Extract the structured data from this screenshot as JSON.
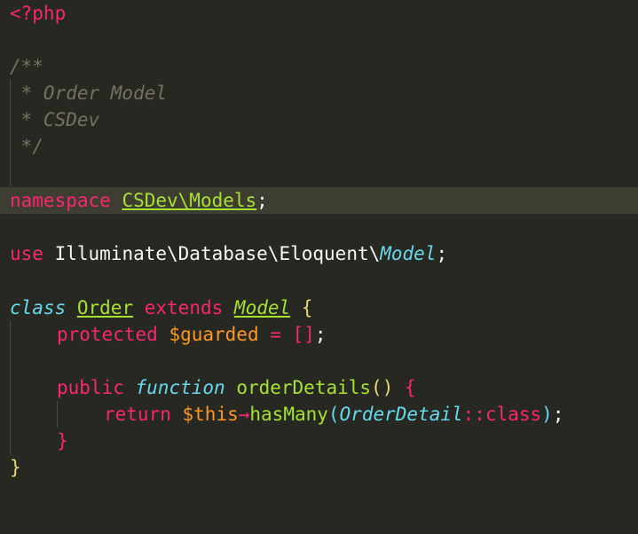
{
  "editor": {
    "language": "php",
    "theme": {
      "background": "#272822",
      "current_line": "#3e3d32",
      "keyword": "#f92672",
      "storage": "#66d9ef",
      "class_name": "#a6e22e",
      "variable": "#fd971f",
      "comment": "#75715e",
      "text": "#f8f8f2"
    },
    "lines": {
      "l1": {
        "open_tag": "<?php"
      },
      "l3": {
        "doc_open": "/**"
      },
      "l4": {
        "doc_text": " * Order Model"
      },
      "l5": {
        "doc_text": " * CSDev"
      },
      "l6": {
        "doc_close": " */"
      },
      "l8": {
        "keyword": "namespace",
        "namespace": "CSDev\\Models",
        "semicolon": ";"
      },
      "l10": {
        "keyword": "use",
        "path": "Illuminate\\Database\\Eloquent\\",
        "class": "Model",
        "semicolon": ";"
      },
      "l12": {
        "storage": "class",
        "class_name": "Order",
        "extends": "extends",
        "parent": "Model",
        "open_brace": "{"
      },
      "l13": {
        "modifier": "protected",
        "variable": "$guarded",
        "operator": "=",
        "open_bracket": "[",
        "close_bracket": "]",
        "semicolon": ";"
      },
      "l15": {
        "modifier": "public",
        "storage": "function",
        "name": "orderDetails",
        "parens": "()",
        "open_brace": "{"
      },
      "l16": {
        "keyword": "return",
        "variable": "$this",
        "arrow": "→",
        "method": "hasMany",
        "open_paren": "(",
        "argument": "OrderDetail",
        "scope": "::",
        "class_kw": "class",
        "close_paren": ")",
        "semicolon": ";"
      },
      "l17": {
        "close_brace": "}"
      },
      "l18": {
        "close_brace": "}"
      }
    }
  }
}
